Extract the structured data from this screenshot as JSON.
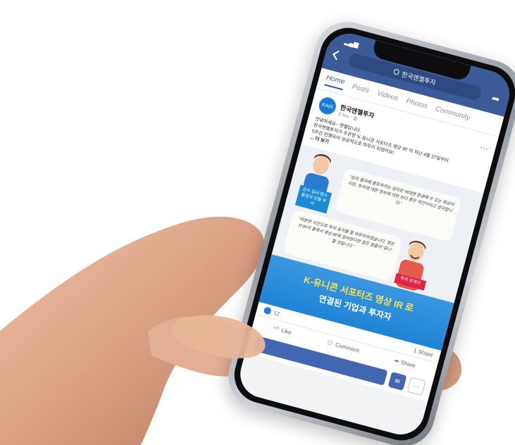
{
  "search": {
    "query": "한국엔젤투자"
  },
  "tabs": [
    "Home",
    "Posts",
    "Videos",
    "Photos",
    "Community"
  ],
  "post": {
    "page_name": "한국엔젤투자",
    "time": "2 hrs",
    "text_lines": [
      "안녕하세요~ 엔젤입니다.",
      "한국엔젤투자가 주관한 'K-유니콘 서포터즈 영상 IR' 이 지난 4월 27일부터",
      "5주간 진행되어 성공적으로 마무리 되었어요!"
    ],
    "see_more": "... 더 보기"
  },
  "media": {
    "quote_1": "\"심의 결과에 중요하지는 않지만 비대면 환경에 수 있는 화상이지만, 투자에 대한 정보에 대한 보다 좋은 여건이라고 생각합니다.\"",
    "quote_2": "\"따분한 시간으로 투자 유치를 잘 마무리하였습니다. 영상서 IR이 통해서 영상 IR에 참여한다면 많은 분들이 '유니' 할 것입니다.\"",
    "sign_1": "강수 업사 청소통원의 인플 부사",
    "sign_2": "투자 관계자",
    "banner_line_1": "K-유니콘 서포터즈 영상 IR 로",
    "banner_line_2": "연결된 기업과 투자자"
  },
  "reactions": {
    "likes": "12",
    "shares": "1 Share"
  },
  "actions": {
    "like": "Like",
    "comment": "Comment",
    "share": "Share"
  },
  "colors": {
    "facebook_blue": "#3b5a98",
    "banner_blue": "#1f84d6",
    "banner_yellow": "#ffe14a",
    "sign_red": "#e22448"
  }
}
